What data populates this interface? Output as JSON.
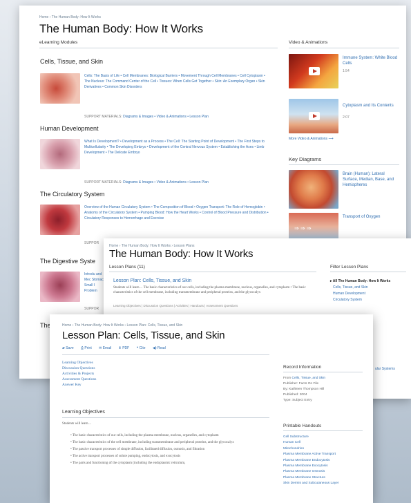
{
  "page1": {
    "breadcrumb": "Home › The Human Body: How It Works",
    "title": "The Human Body: How It Works",
    "elearning_heading": "eLearning Modules",
    "modules": [
      {
        "title": "Cells, Tissue, and Skin",
        "links": "Cells: The Basis of Life • Cell Membranes: Biological Barriers • Movement Through Cell Membranes • Cell Cytoplasm • The Nucleus: The Command Center of the Cell • Tissues: When Cells Get Together • Skin: An Exemplary Organ • Skin Derivatives • Common Skin Disorders",
        "support": "SUPPORT MATERIALS: ",
        "support_links": "Diagrams & Images • Video & Animations • Lesson Plan"
      },
      {
        "title": "Human Development",
        "links": "What Is Development? • Development as a Process • The Cell: The Starting Point of Development • The First Steps to Multicellularity • The Developing Embryo • Development of the Central Nervous System • Establishing the Axes • Limb Development • The Delicate Embryo",
        "support": "SUPPORT MATERIALS: ",
        "support_links": "Diagrams & Images • Video & Animations • Lesson Plan"
      },
      {
        "title": "The Circulatory System",
        "links": "Overview of the Human Circulatory System • The Composition of Blood • Oxygen Transport: The Role of Hemoglobin • Anatomy of the Circulatory System • Pumping Blood: How the Heart Works • Control of Blood Pressure and Distribution • Circulatory Responses to Hemorrhage and Exercise",
        "support": "SUPPOR"
      },
      {
        "title": "The Digestive Syste",
        "links": "Introdu and Mec Stomac Small I Problem",
        "support": "SUPPOR"
      },
      {
        "title": "The",
        "links": "",
        "support": ""
      }
    ],
    "video_heading": "Video & Animations",
    "videos": [
      {
        "title": "Immune System: White Blood Cells",
        "duration": "1:54"
      },
      {
        "title": "Cytoplasm and Its Contents",
        "duration": "2:07"
      }
    ],
    "more_videos": "More Video & Animations ⟶",
    "diagrams_heading": "Key Diagrams",
    "diagrams": [
      {
        "title": "Brain (Human): Lateral Surface, Median, Base, and Hemispheres"
      },
      {
        "title": "Transport of Oxygen"
      }
    ]
  },
  "page2": {
    "breadcrumb": "Home › The Human Body: How It Works › Lesson Plans",
    "title": "The Human Body: How It Works",
    "count": "Lesson Plans (11)",
    "lesson_title": "Lesson Plan: Cells, Tissue, and Skin",
    "lesson_desc": "Students will learn… The basic characteristics of our cells, including the plasma membrane, nucleus, organelles, and cytoplasm • The basic characteristics of the cell membrane, including transmembrane and peripheral proteins, and the glycocalyx",
    "lesson_meta": "Learning Objectives | Discussion Questions | Activities | Handouts | Assessment Questions",
    "filter_heading": "Filter Lesson Plans",
    "filters": [
      "▸ All The Human Body: How It Works",
      "Cells, Tissue, and Skin",
      "Human Development",
      "Circulatory System"
    ],
    "cut_text": "ular Systems"
  },
  "page3": {
    "breadcrumb": "Home › The Human Body: How It Works › Lesson Plan: Cells, Tissue, and Skin",
    "title": "Lesson Plan: Cells, Tissue, and Skin",
    "toolbar": [
      "Save",
      "Print",
      "Email",
      "PDF",
      "Cite",
      "Read"
    ],
    "toc": [
      "Learning Objectives",
      "Discussion Questions",
      "Activities & Projects",
      "Assessment Questions",
      "Answer Key"
    ],
    "objectives_heading": "Learning Objectives",
    "students_line": "Students will learn…",
    "bullets": [
      "The basic characteristics of our cells, including the plasma membrane, nucleus, organelles, and cytoplasm",
      "The basic characteristics of the cell membrane, including transmembrane and peripheral proteins, and the glycocalyx",
      "The passive transport processes of simple diffusion, facilitated diffusion, osmosis, and filtration",
      "The active transport processes of solute pumping, endocytosis, and exocytosis",
      "The parts and functioning of the cytoplasm (including the endoplasmic reticulum,"
    ],
    "record_heading": "Record Information",
    "record": [
      {
        "label": "From ",
        "value": "Cells, Tissue, and Skin"
      },
      {
        "label": "Publisher: ",
        "value": "Facts On File"
      },
      {
        "label": "By: ",
        "value": "Kathleen Thompson Hill"
      },
      {
        "label": "Published: ",
        "value": "2004"
      },
      {
        "label": "Type: ",
        "value": "Subject Entry"
      }
    ],
    "handouts_heading": "Printable Handouts",
    "handouts": [
      "Cell Substructure",
      "Human Cell",
      "Mitochondrion",
      "Plasma Membrane Active Transport",
      "Plasma Membrane Endocytosis",
      "Plasma Membrane Exocytosis",
      "Plasma Membrane Osmosis",
      "Plasma Membrane Structure",
      "Skin Dermis and Subcutaneous Layer"
    ]
  }
}
